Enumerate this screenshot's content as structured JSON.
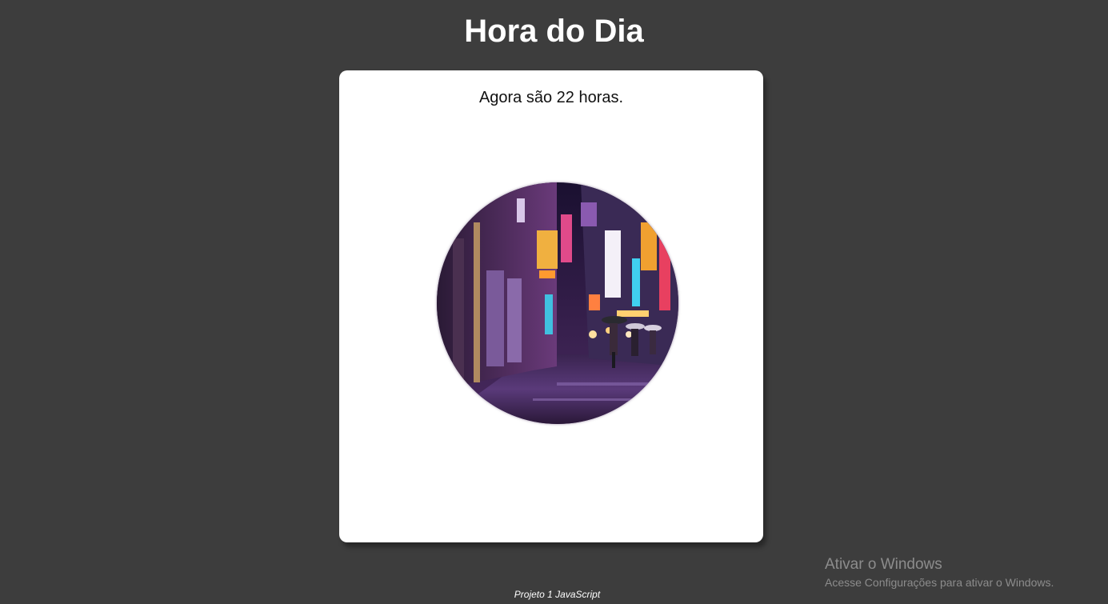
{
  "page": {
    "title": "Hora do Dia",
    "footer": "Projeto 1 JavaScript"
  },
  "card": {
    "message": "Agora são 22 horas.",
    "image_alt": "Rua de Tóquio à noite com letreiros de néon"
  },
  "overlay": {
    "activation_title": "Ativar o Windows",
    "activation_subtitle": "Acesse Configurações para ativar o Windows."
  },
  "colors": {
    "background": "#3d3d3d",
    "card": "#ffffff",
    "title": "#ffffff",
    "watermark": "#8c8c8c"
  }
}
